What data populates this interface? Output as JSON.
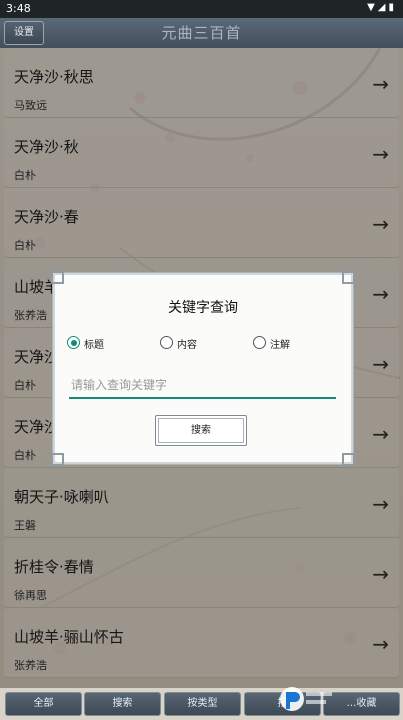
{
  "status": {
    "time": "3:48",
    "icons": "▼◢▮"
  },
  "header": {
    "settings_label": "设置",
    "title": "元曲三百首"
  },
  "list": [
    {
      "title": "天净沙·秋思",
      "author": "马致远"
    },
    {
      "title": "天净沙·秋",
      "author": "白朴"
    },
    {
      "title": "天净沙·春",
      "author": "白朴"
    },
    {
      "title": "山坡羊",
      "author": "张养浩"
    },
    {
      "title": "天净沙",
      "author": "白朴"
    },
    {
      "title": "天净沙",
      "author": "白朴"
    },
    {
      "title": "朝天子·咏喇叭",
      "author": "王磐"
    },
    {
      "title": "折桂令·春情",
      "author": "徐再思"
    },
    {
      "title": "山坡羊·骊山怀古",
      "author": "张养浩"
    }
  ],
  "dialog": {
    "title": "关键字查询",
    "options": [
      "标题",
      "内容",
      "注解"
    ],
    "selected": "标题",
    "placeholder": "请输入查询关键字",
    "button": "搜索"
  },
  "bottom_tabs": [
    "全部",
    "搜索",
    "按类型",
    "按",
    "…收藏"
  ]
}
